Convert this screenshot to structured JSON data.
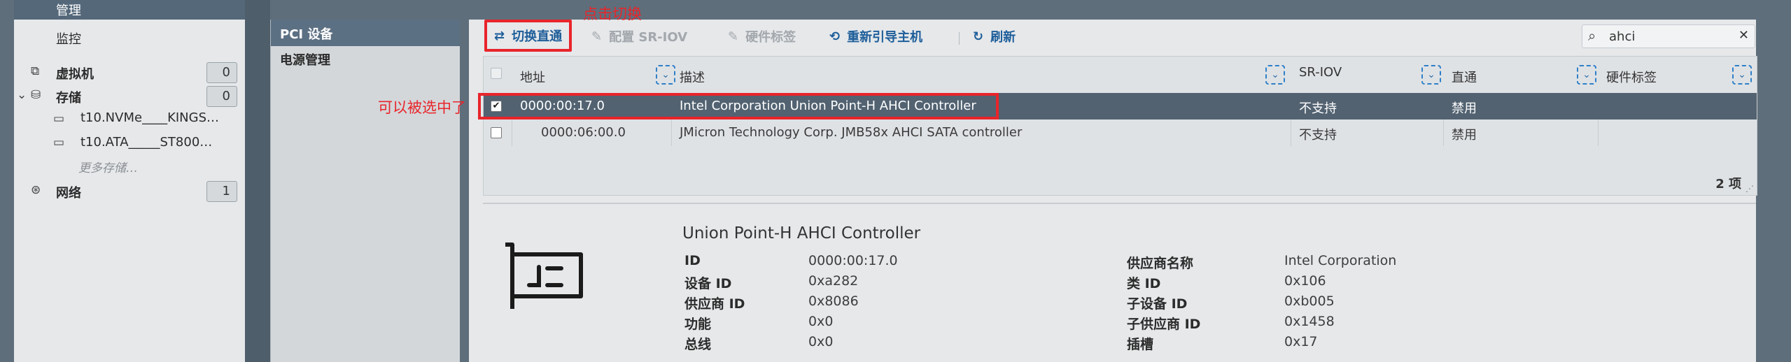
{
  "nav": {
    "manage_label": "管理",
    "monitor_label": "监控",
    "vm_label": "虚拟机",
    "vm_count": "0",
    "storage_label": "存储",
    "storage_count": "0",
    "storage_items": [
      "t10.NVMe____KINGS…",
      "t10.ATA_____ST800…"
    ],
    "more_storage": "更多存储…",
    "network_label": "网络",
    "network_count": "1"
  },
  "menu": {
    "items": [
      "PCI 设备",
      "电源管理"
    ]
  },
  "toolbar": {
    "switch_label": "切换直通",
    "sriov_label": "配置 SR-IOV",
    "hwlabel_label": "硬件标签",
    "reboot_label": "重新引导主机",
    "refresh_label": "刷新"
  },
  "search": {
    "value": "ahci"
  },
  "grid": {
    "columns": [
      "地址",
      "描述",
      "SR-IOV",
      "直通",
      "硬件标签"
    ],
    "rows": [
      {
        "address": "0000:00:17.0",
        "description": "Intel Corporation Union Point-H AHCI Controller",
        "sriov": "不支持",
        "passthrough": "禁用",
        "hwlabel": "",
        "checked": true
      },
      {
        "address": "0000:06:00.0",
        "description": "JMicron Technology Corp. JMB58x AHCI SATA controller",
        "sriov": "不支持",
        "passthrough": "禁用",
        "hwlabel": "",
        "checked": false
      }
    ],
    "count_label": "2 项"
  },
  "details": {
    "title": "Union Point-H AHCI Controller",
    "left": [
      {
        "k": "ID",
        "v": "0000:00:17.0"
      },
      {
        "k": "设备 ID",
        "v": "0xa282"
      },
      {
        "k": "供应商 ID",
        "v": "0x8086"
      },
      {
        "k": "功能",
        "v": "0x0"
      },
      {
        "k": "总线",
        "v": "0x0"
      }
    ],
    "right": [
      {
        "k": "供应商名称",
        "v": "Intel Corporation"
      },
      {
        "k": "类 ID",
        "v": "0x106"
      },
      {
        "k": "子设备 ID",
        "v": "0xb005"
      },
      {
        "k": "子供应商 ID",
        "v": "0x1458"
      },
      {
        "k": "插槽",
        "v": "0x17"
      }
    ]
  },
  "annotations": {
    "click_switch": "点击切换",
    "selectable": "可以被选中了"
  },
  "colors": {
    "accent": "#1e5e9a",
    "annotation": "#e8252b",
    "selected_row": "#526271"
  }
}
